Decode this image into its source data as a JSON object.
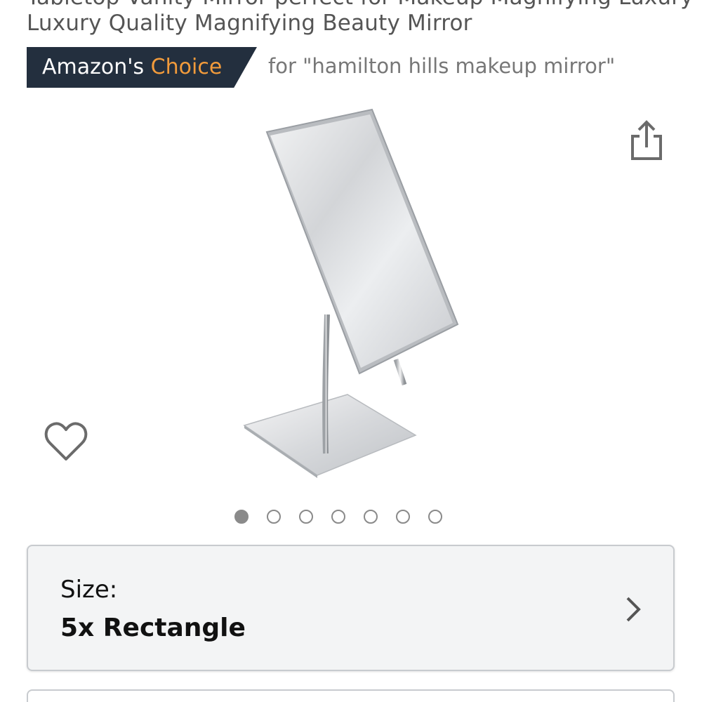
{
  "product": {
    "title_line_1": "Tabletop Vanity Mirror perfect for Makeup Magnifying Luxury",
    "title_line_2": "Luxury Quality Magnifying Beauty Mirror",
    "image_alt": "Rectangular chrome magnifying makeup mirror on square stand"
  },
  "badge": {
    "amazon": "Amazon's",
    "choice": "Choice",
    "query": "for \"hamilton hills makeup mirror\""
  },
  "colors": {
    "badge_bg": "#232f3e",
    "badge_accent": "#f29b3b",
    "dot": "#8a8a8a"
  },
  "carousel": {
    "total": 7,
    "active_index": 0
  },
  "size_selector": {
    "label": "Size:",
    "value": "5x Rectangle"
  },
  "icons": {
    "share": "share-icon",
    "wishlist": "heart-icon",
    "open": "chevron-right-icon"
  }
}
